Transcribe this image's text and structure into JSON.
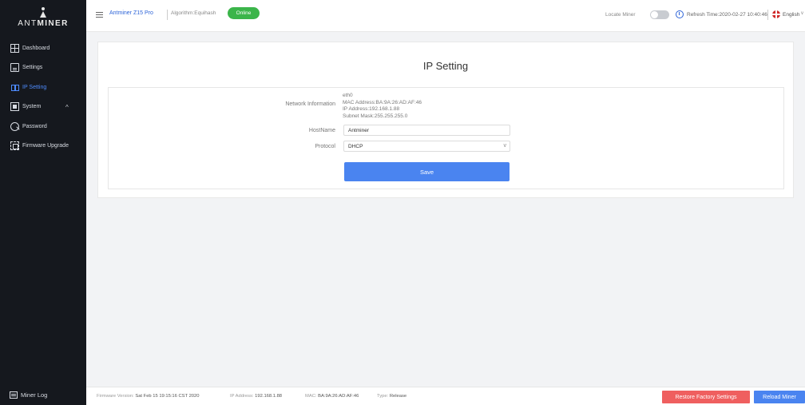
{
  "sidebar": {
    "logo_prefix": "ANT",
    "logo_suffix": "MINER",
    "items": [
      {
        "label": "Dashboard",
        "icon": "dashboard-icon"
      },
      {
        "label": "Settings",
        "icon": "settings-icon"
      },
      {
        "label": "IP Setting",
        "icon": "network-icon",
        "active": true
      },
      {
        "label": "System",
        "icon": "system-icon"
      },
      {
        "label": "Password",
        "icon": "key-icon"
      },
      {
        "label": "Firmware Upgrade",
        "icon": "chip-icon"
      }
    ],
    "miner_log": "Miner Log"
  },
  "header": {
    "model": "Antminer Z15 Pro",
    "algorithm": "Algorithm:Equihash",
    "status": "Online",
    "locate_miner": "Locate Miner",
    "refresh_time": "Refresh Time:2020-02-27 10:40:46",
    "language": "English",
    "colors": {
      "status": "#3bb54a",
      "link": "#2d64d8"
    }
  },
  "main": {
    "title": "IP Setting",
    "network_label": "Network Information",
    "network_info": {
      "iface": "eth0",
      "mac": "MAC Address:BA:9A:26:AD:AF:46",
      "ip": "IP Address:192.168.1.88",
      "mask": "Subnet Mask:255.255.255.0"
    },
    "hostname_label": "HostName",
    "hostname_value": "Antminer",
    "protocol_label": "Protocol",
    "protocol_value": "DHCP",
    "save_label": "Save"
  },
  "footer": {
    "firmware_label": "Firmware Version:",
    "firmware_value": "Sat Feb 15 19:15:16 CST 2020",
    "ip_label": "IP Address:",
    "ip_value": "192.168.1.88",
    "mac_label": "MAC:",
    "mac_value": "BA:9A:26:AD:AF:46",
    "type_label": "Type:",
    "type_value": "Release",
    "restore_label": "Restore Factory Settings",
    "reload_label": "Reload Miner",
    "colors": {
      "restore": "#ef5f5f",
      "reload": "#4a84f0"
    }
  }
}
